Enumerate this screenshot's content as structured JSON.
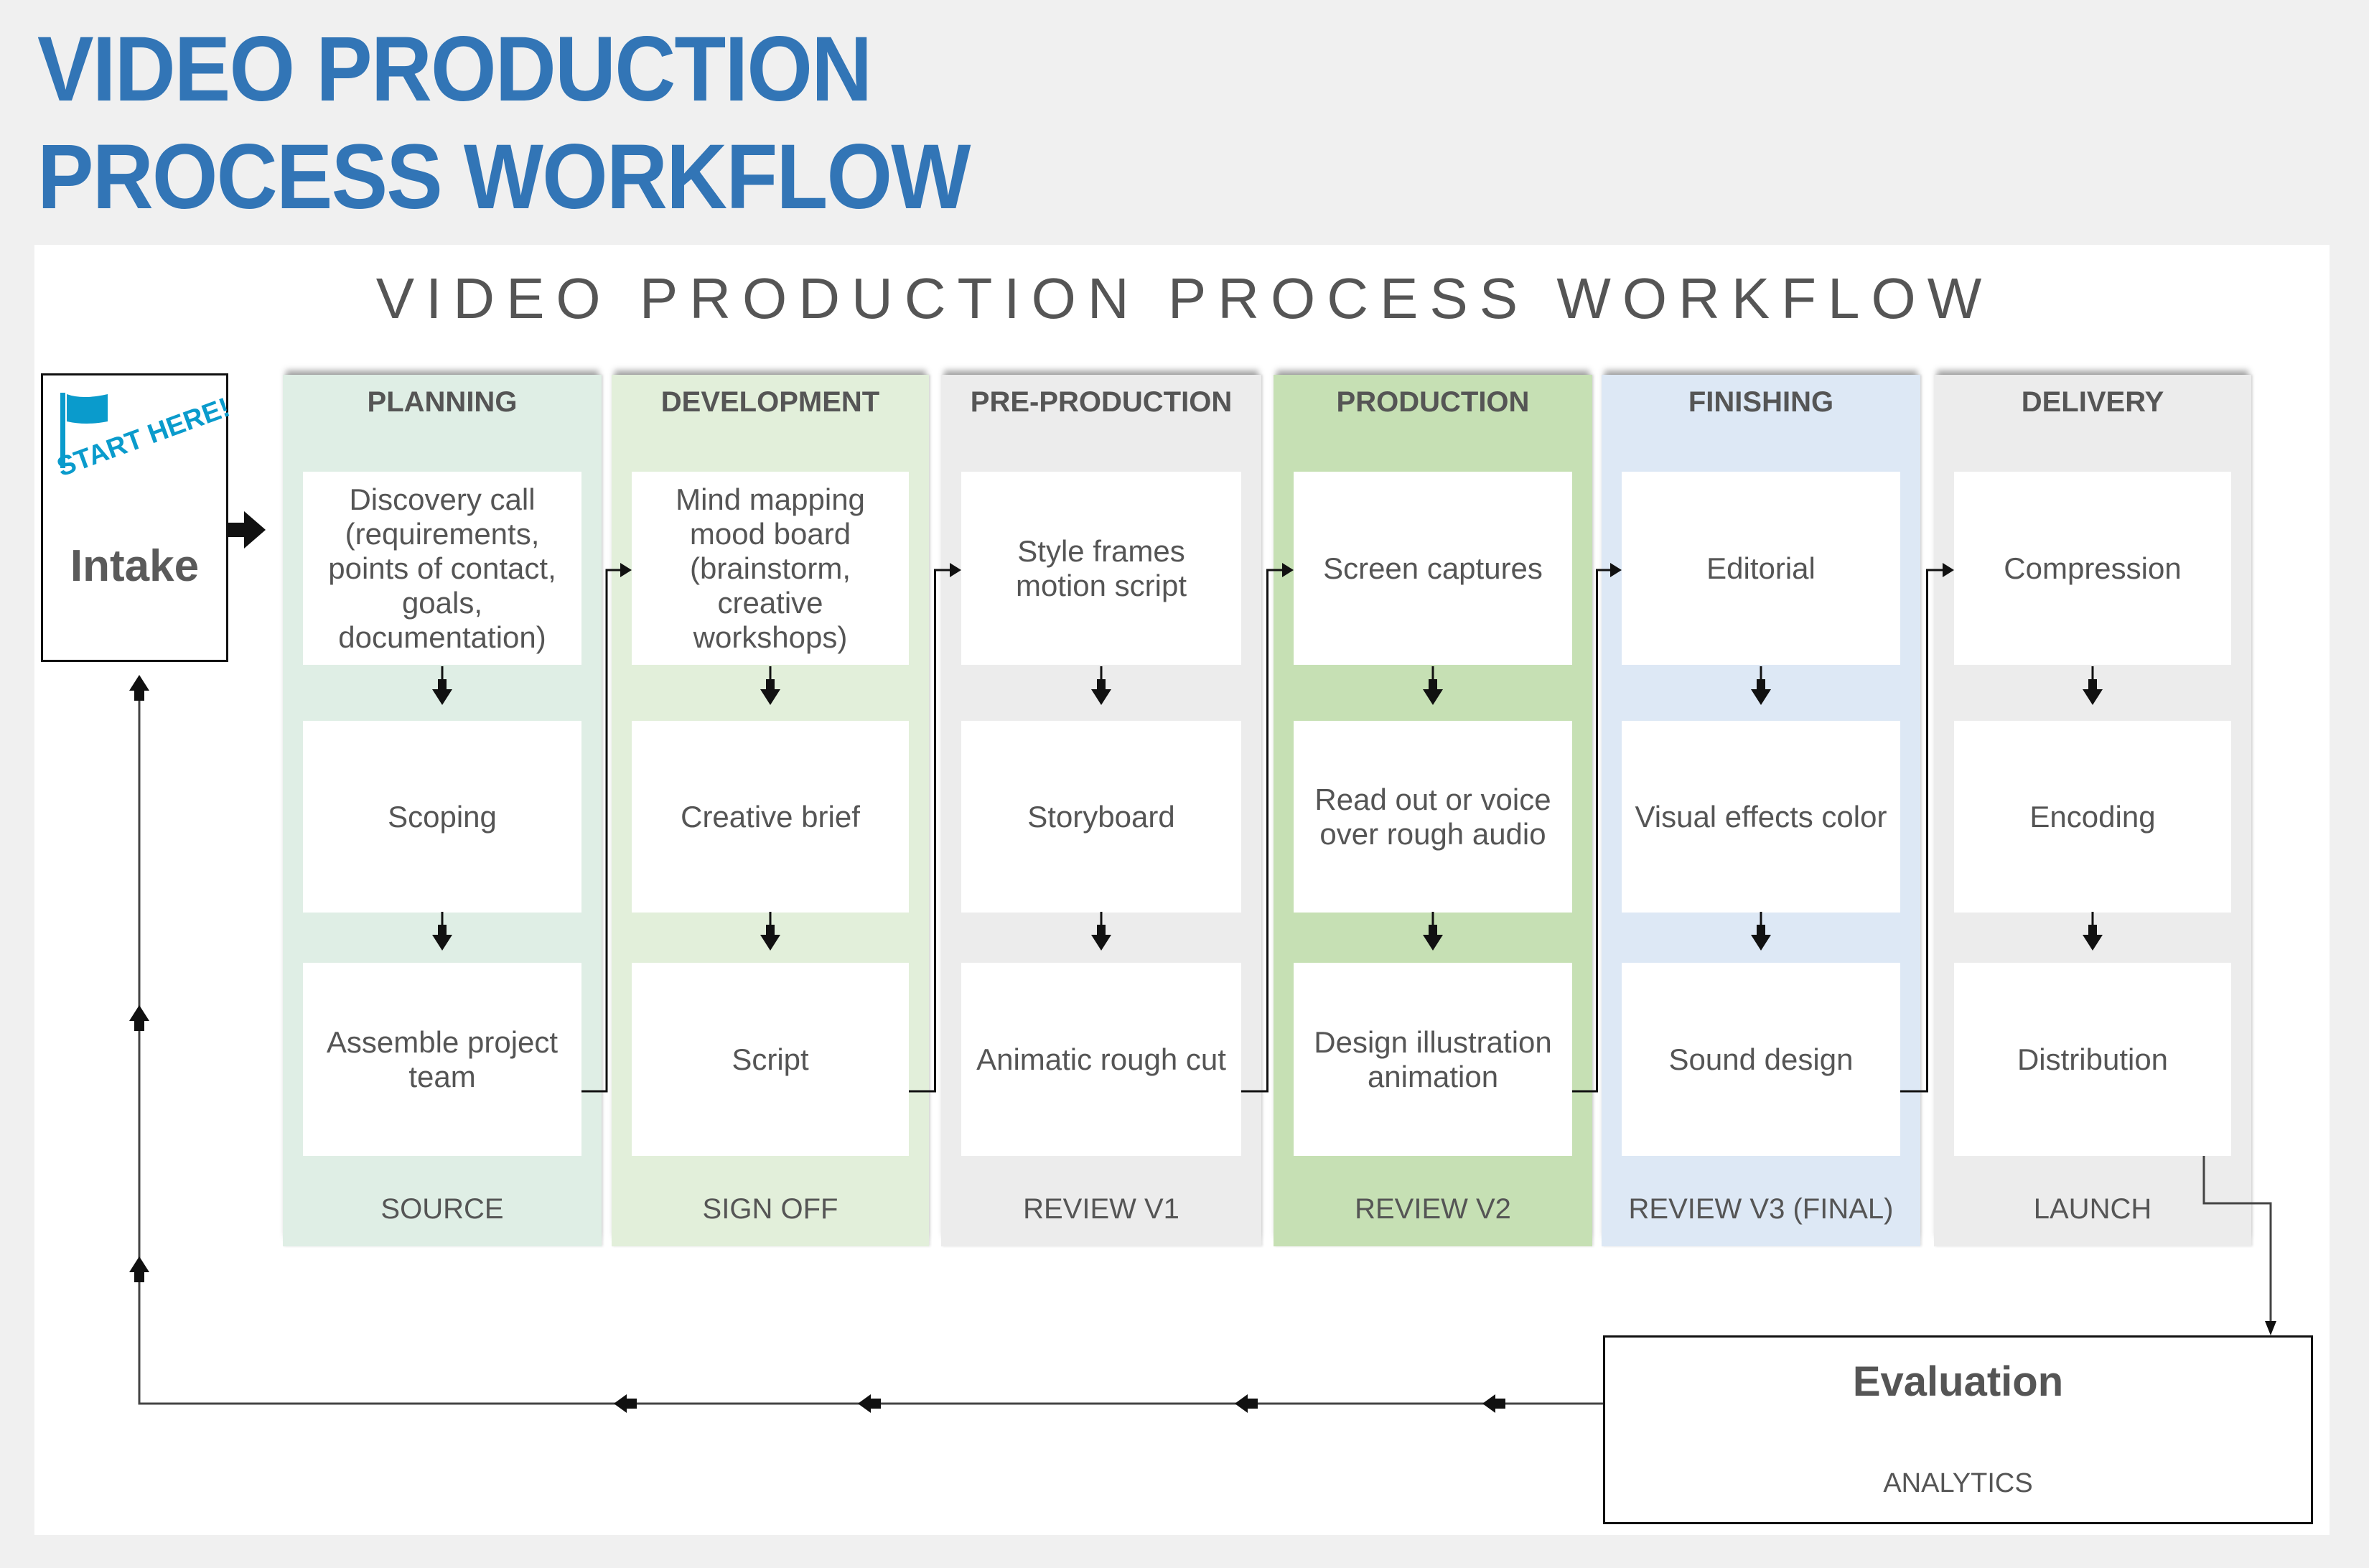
{
  "page_title_line1": "VIDEO PRODUCTION",
  "page_title_line2": "PROCESS WORKFLOW",
  "diagram_title": "VIDEO PRODUCTION PROCESS WORKFLOW",
  "intake": {
    "badge": "START HERE!",
    "label": "Intake",
    "icon": "flag-icon"
  },
  "columns": [
    {
      "header": "PLANNING",
      "color": "#dfeee5",
      "steps": [
        "Discovery call (requirements, points of contact, goals, documentation)",
        "Scoping",
        "Assemble project team"
      ],
      "footer": "SOURCE"
    },
    {
      "header": "DEVELOPMENT",
      "color": "#e2efda",
      "steps": [
        "Mind mapping mood board (brainstorm, creative workshops)",
        "Creative brief",
        "Script"
      ],
      "footer": "SIGN OFF"
    },
    {
      "header": "PRE-PRODUCTION",
      "color": "#ececec",
      "steps": [
        "Style frames motion script",
        "Storyboard",
        "Animatic rough cut"
      ],
      "footer": "REVIEW V1"
    },
    {
      "header": "PRODUCTION",
      "color": "#c6e0b4",
      "steps": [
        "Screen captures",
        "Read out or voice over rough audio",
        "Design illustration animation"
      ],
      "footer": "REVIEW V2"
    },
    {
      "header": "FINISHING",
      "color": "#dde8f5",
      "steps": [
        "Editorial",
        "Visual effects color",
        "Sound design"
      ],
      "footer": "REVIEW V3 (FINAL)"
    },
    {
      "header": "DELIVERY",
      "color": "#ececec",
      "steps": [
        "Compression",
        "Encoding",
        "Distribution"
      ],
      "footer": "LAUNCH"
    }
  ],
  "evaluation": {
    "title": "Evaluation",
    "subtitle": "ANALYTICS"
  },
  "colors": {
    "title_blue": "#3275b6",
    "start_blue": "#0a9bcc",
    "text_gray": "#555555"
  }
}
